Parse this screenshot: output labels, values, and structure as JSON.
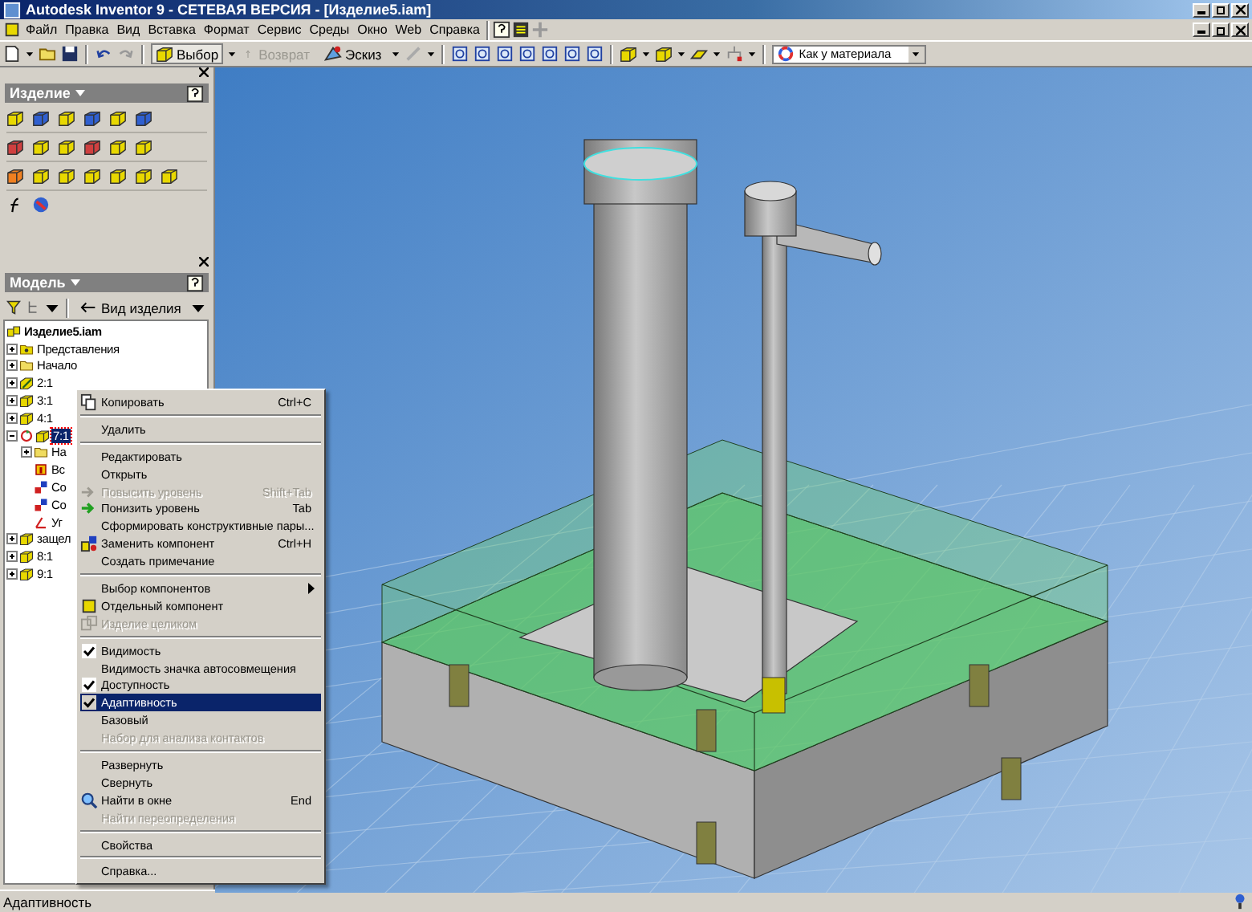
{
  "window": {
    "title": "Autodesk Inventor 9  - СЕТЕВАЯ ВЕРСИЯ - [Изделие5.iam]"
  },
  "menu_bar": [
    "Файл",
    "Правка",
    "Вид",
    "Вставка",
    "Формат",
    "Сервис",
    "Среды",
    "Окно",
    "Web",
    "Справка"
  ],
  "toolbar": {
    "select_button": "Выбор",
    "return_button": {
      "label": "Возврат",
      "disabled": true
    },
    "sketch_button": "Эскиз",
    "display_style": "Как у материала"
  },
  "assembly_panel": {
    "title": "Изделие"
  },
  "model_panel": {
    "title": "Модель",
    "view_button": "Вид изделия"
  },
  "tree": [
    {
      "label": "Изделие5.iam",
      "kind": "assembly",
      "selected": false,
      "children": [
        {
          "label": "Представления",
          "kind": "views",
          "expanded": false,
          "selected": false
        },
        {
          "label": "Начало",
          "kind": "folder",
          "expanded": false,
          "selected": false
        },
        {
          "label": "2:1",
          "kind": "pencil",
          "expanded": false,
          "selected": false
        },
        {
          "label": "3:1",
          "kind": "part",
          "expanded": false,
          "selected": false
        },
        {
          "label": "4:1",
          "kind": "part",
          "expanded": false,
          "selected": false
        },
        {
          "label": "7:1",
          "kind": "adaptive",
          "expanded": true,
          "selected": true,
          "children": [
            {
              "label": "На",
              "kind": "folder",
              "expanded": false,
              "selected": false
            },
            {
              "label": "Вс",
              "kind": "constraint",
              "selected": false
            },
            {
              "label": "Со",
              "kind": "joint",
              "selected": false
            },
            {
              "label": "Со",
              "kind": "joint",
              "selected": false
            },
            {
              "label": "Уг",
              "kind": "angle",
              "selected": false
            }
          ]
        },
        {
          "label": "защел",
          "kind": "part",
          "expanded": false,
          "selected": false
        },
        {
          "label": "8:1",
          "kind": "part",
          "expanded": false,
          "selected": false
        },
        {
          "label": "9:1",
          "kind": "part",
          "expanded": false,
          "selected": false
        }
      ]
    }
  ],
  "context_menu": [
    {
      "kind": "item",
      "label": "Копировать",
      "shortcut": "Ctrl+C",
      "disabled": false,
      "checked": false,
      "selected": false
    },
    {
      "kind": "separator"
    },
    {
      "kind": "item",
      "label": "Удалить",
      "disabled": false,
      "checked": false,
      "selected": false
    },
    {
      "kind": "separator"
    },
    {
      "kind": "item",
      "label": "Редактировать",
      "disabled": false,
      "checked": false,
      "selected": false
    },
    {
      "kind": "item",
      "label": "Открыть",
      "disabled": false,
      "checked": false,
      "selected": false
    },
    {
      "kind": "item",
      "label": "Повысить уровень",
      "shortcut": "Shift+Tab",
      "disabled": true,
      "checked": false,
      "selected": false
    },
    {
      "kind": "item",
      "label": "Понизить уровень",
      "shortcut": "Tab",
      "disabled": false,
      "checked": false,
      "selected": false
    },
    {
      "kind": "item",
      "label": "Сформировать конструктивные пары...",
      "disabled": false,
      "checked": false,
      "selected": false
    },
    {
      "kind": "item",
      "label": "Заменить компонент",
      "shortcut": "Ctrl+H",
      "disabled": false,
      "checked": false,
      "selected": false
    },
    {
      "kind": "item",
      "label": "Создать примечание",
      "disabled": false,
      "checked": false,
      "selected": false
    },
    {
      "kind": "separator"
    },
    {
      "kind": "submenu",
      "label": "Выбор компонентов",
      "disabled": false,
      "checked": false,
      "selected": false
    },
    {
      "kind": "item",
      "label": "Отдельный компонент",
      "disabled": false,
      "checked": false,
      "selected": false
    },
    {
      "kind": "item",
      "label": "Изделие целиком",
      "disabled": true,
      "checked": false,
      "selected": false
    },
    {
      "kind": "separator"
    },
    {
      "kind": "item",
      "label": "Видимость",
      "disabled": false,
      "checked": true,
      "selected": false
    },
    {
      "kind": "item",
      "label": "Видимость значка автосовмещения",
      "disabled": false,
      "checked": false,
      "selected": false
    },
    {
      "kind": "item",
      "label": "Доступность",
      "disabled": false,
      "checked": true,
      "selected": false
    },
    {
      "kind": "item",
      "label": "Адаптивность",
      "disabled": false,
      "checked": true,
      "selected": true
    },
    {
      "kind": "item",
      "label": "Базовый",
      "disabled": false,
      "checked": false,
      "selected": false
    },
    {
      "kind": "item",
      "label": "Набор для анализа контактов",
      "disabled": true,
      "checked": false,
      "selected": false
    },
    {
      "kind": "separator"
    },
    {
      "kind": "item",
      "label": "Развернуть",
      "disabled": false,
      "checked": false,
      "selected": false
    },
    {
      "kind": "item",
      "label": "Свернуть",
      "disabled": false,
      "checked": false,
      "selected": false
    },
    {
      "kind": "item",
      "label": "Найти в окне",
      "shortcut": "End",
      "disabled": false,
      "checked": false,
      "selected": false
    },
    {
      "kind": "item",
      "label": "Найти переопределения",
      "disabled": true,
      "checked": false,
      "selected": false
    },
    {
      "kind": "separator"
    },
    {
      "kind": "item",
      "label": "Свойства",
      "disabled": false,
      "checked": false,
      "selected": false
    },
    {
      "kind": "separator"
    },
    {
      "kind": "item",
      "label": "Справка...",
      "disabled": false,
      "checked": false,
      "selected": false
    }
  ],
  "status_bar": {
    "text": "Адаптивность"
  }
}
